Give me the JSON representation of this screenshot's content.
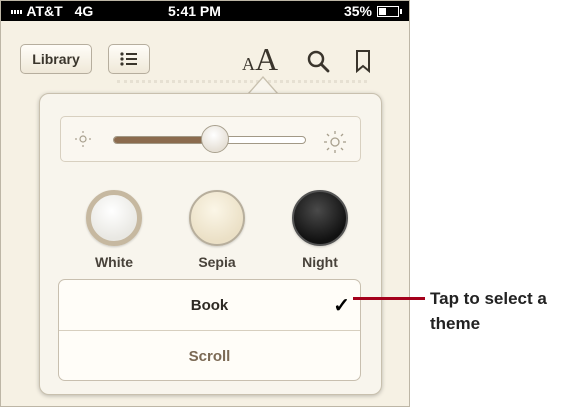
{
  "status": {
    "carrier": "AT&T",
    "network": "4G",
    "time": "5:41 PM",
    "battery": "35%"
  },
  "toolbar": {
    "library_label": "Library",
    "font_small": "A",
    "font_large": "A",
    "toc_icon": "list-icon",
    "search_icon": "search-icon",
    "bookmark_icon": "bookmark-icon"
  },
  "brightness": {
    "level": 0.53,
    "min_icon": "sun-low-icon",
    "max_icon": "sun-high-icon"
  },
  "themes": [
    {
      "label": "White",
      "color": "#f9f9f7"
    },
    {
      "label": "Sepia",
      "color": "#f3ebd7"
    },
    {
      "label": "Night",
      "color": "#111111"
    }
  ],
  "modes": {
    "book": "Book",
    "scroll": "Scroll",
    "selected_mark": "✓"
  },
  "callout": {
    "text": "Tap to select a theme"
  }
}
